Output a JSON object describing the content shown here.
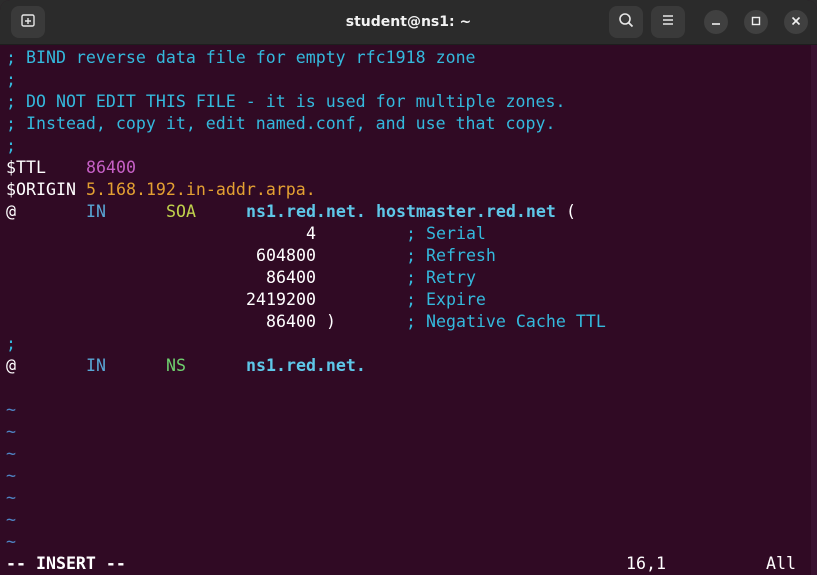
{
  "window": {
    "title": "student@ns1: ~"
  },
  "titlebar_icons": {
    "new_tab": "new-tab-icon",
    "search": "search-icon",
    "menu": "hamburger-menu-icon",
    "minimize": "minimize-icon",
    "maximize": "maximize-icon",
    "close": "close-icon"
  },
  "editor": {
    "lines": {
      "l1": "; BIND reverse data file for empty rfc1918 zone",
      "l2": ";",
      "l3": "; DO NOT EDIT THIS FILE - it is used for multiple zones.",
      "l4": "; Instead, copy it, edit named.conf, and use that copy.",
      "l5": ";",
      "ttl_kw": "$TTL",
      "ttl_val": "86400",
      "origin_kw": "$ORIGIN",
      "origin_val": "5.168.192.in-addr.arpa.",
      "soa_at": "@",
      "soa_in": "IN",
      "soa_type": "SOA",
      "soa_ns": "ns1.red.net.",
      "soa_host": "hostmaster.red.net",
      "soa_paren": "(",
      "serial_num": "4",
      "serial_c": "; Serial",
      "refresh_num": "604800",
      "refresh_c": "; Refresh",
      "retry_num": "86400",
      "retry_c": "; Retry",
      "expire_num": "2419200",
      "expire_c": "; Expire",
      "negttl_num": "86400",
      "negttl_paren": ")",
      "negttl_c": "; Negative Cache TTL",
      "l13": ";",
      "ns_at": "@",
      "ns_in": "IN",
      "ns_type": "NS",
      "ns_host": "ns1.red.net."
    },
    "tilde": "~"
  },
  "status_bar": {
    "mode": "-- INSERT --",
    "position": "16,1",
    "scroll": "All"
  },
  "colors": {
    "terminal_bg": "#300a24",
    "titlebar_bg": "#2b2b2b",
    "comment": "#34b9dd",
    "ttl": "#c660c6",
    "origin": "#e3a032",
    "hostname": "#5ec7e8"
  }
}
